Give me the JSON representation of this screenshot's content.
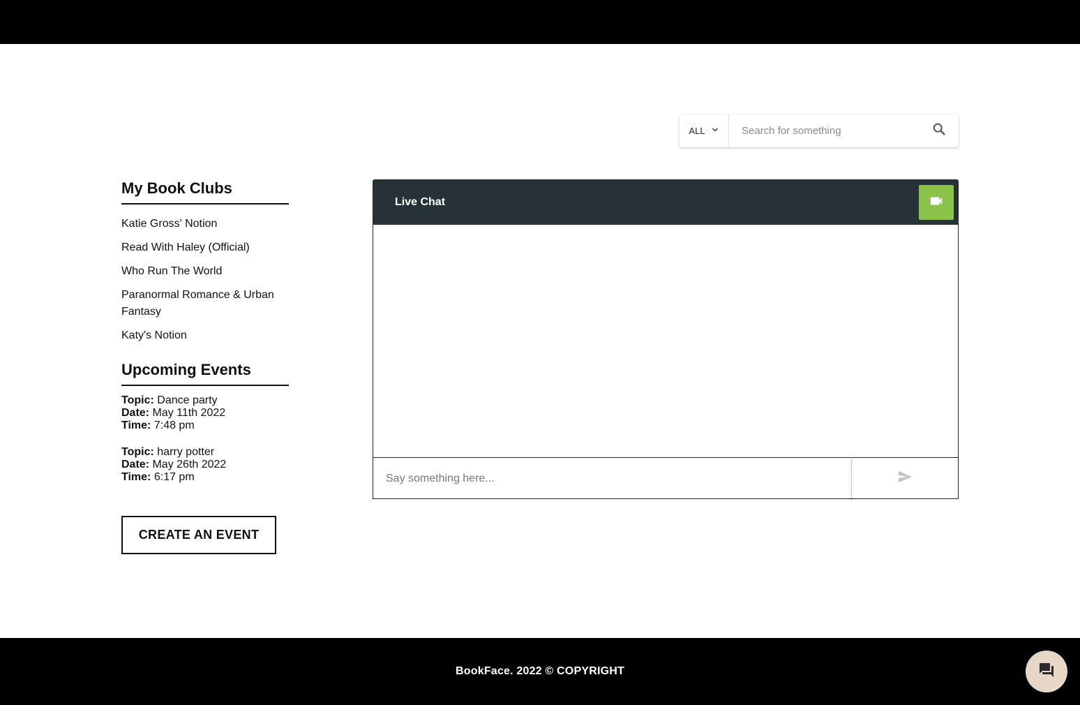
{
  "search": {
    "scope_label": "ALL",
    "placeholder": "Search for something",
    "value": ""
  },
  "sidebar": {
    "clubs_title": "My Book Clubs",
    "clubs": [
      "Katie Gross' Notion",
      "Read With Haley (Official)",
      "Who Run The World",
      "Paranormal Romance & Urban Fantasy",
      "Katy's Notion"
    ],
    "events_title": "Upcoming Events",
    "field_labels": {
      "topic": "Topic:",
      "date": "Date:",
      "time": "Time:"
    },
    "events": [
      {
        "topic": "Dance party",
        "date": "May 11th 2022",
        "time": "7:48 pm"
      },
      {
        "topic": "harry potter",
        "date": "May 26th 2022",
        "time": "6:17 pm"
      }
    ],
    "create_event_label": "CREATE AN EVENT"
  },
  "chat": {
    "title": "Live Chat",
    "video_icon": "videocam-icon",
    "input_placeholder": "Say something here...",
    "input_value": "",
    "send_icon": "send-icon",
    "messages": []
  },
  "footer": {
    "text": "BookFace. 2022 © COPYRIGHT",
    "chat_fab_icon": "forum-icon"
  },
  "colors": {
    "header_bg": "#000000",
    "chat_header_bg": "#263238",
    "video_button": "#8bc34a",
    "fab_bg": "#e8d6c6"
  }
}
